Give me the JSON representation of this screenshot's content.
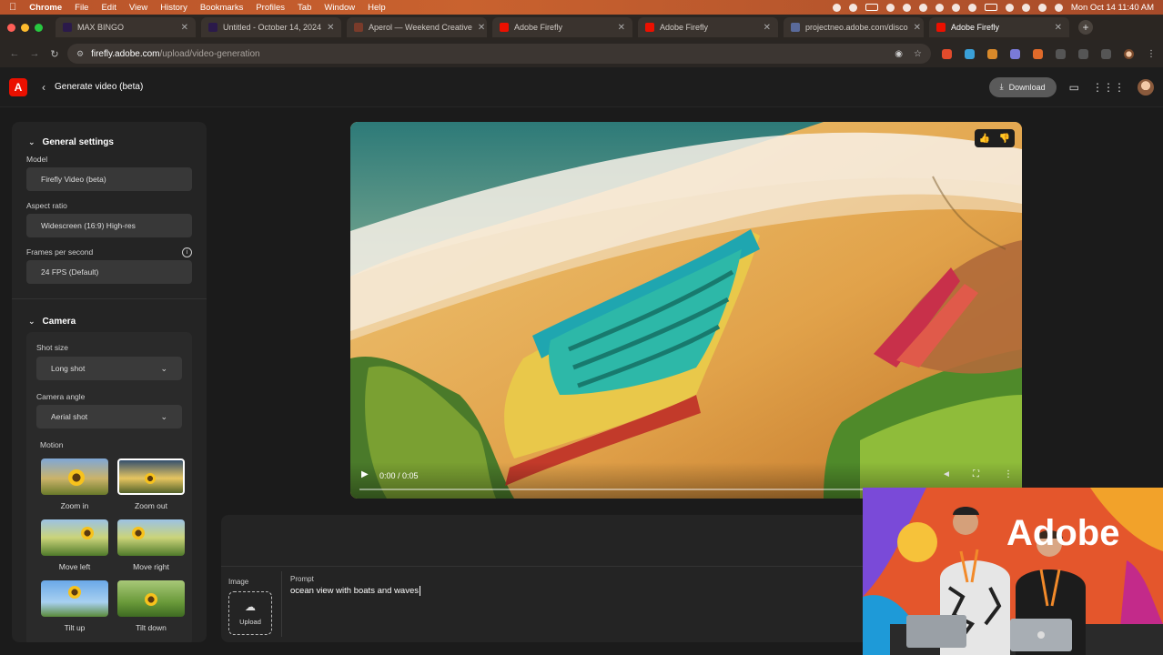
{
  "menubar": {
    "app": "Chrome",
    "items": [
      "File",
      "Edit",
      "View",
      "History",
      "Bookmarks",
      "Profiles",
      "Tab",
      "Window",
      "Help"
    ],
    "clock": "Mon Oct 14  11:40 AM"
  },
  "tabs": [
    {
      "title": "MAX BINGO",
      "favicon_color": "#2b1a4a"
    },
    {
      "title": "Untitled - October 14, 2024",
      "favicon_color": "#2b1a4a"
    },
    {
      "title": "Aperol — Weekend Creative",
      "favicon_color": "#7a3b2a"
    },
    {
      "title": "Adobe Firefly",
      "favicon_color": "#eb1000"
    },
    {
      "title": "Adobe Firefly",
      "favicon_color": "#eb1000"
    },
    {
      "title": "projectneo.adobe.com/disco",
      "favicon_color": "#5a6a9a"
    },
    {
      "title": "Adobe Firefly",
      "favicon_color": "#eb1000",
      "active": true
    }
  ],
  "address": {
    "host": "firefly.adobe.com",
    "path": "/upload/video-generation"
  },
  "header": {
    "title": "Generate video (beta)",
    "download_label": "Download",
    "logo_letter": "A"
  },
  "sidebar": {
    "general": {
      "title": "General settings",
      "model_label": "Model",
      "model_value": "Firefly Video (beta)",
      "aspect_label": "Aspect ratio",
      "aspect_value": "Widescreen (16:9) High-res",
      "fps_label": "Frames per second",
      "fps_value": "24 FPS (Default)"
    },
    "camera": {
      "title": "Camera",
      "shot_label": "Shot size",
      "shot_value": "Long shot",
      "angle_label": "Camera angle",
      "angle_value": "Aerial shot",
      "motion_label": "Motion",
      "motions": [
        "Zoom in",
        "Zoom out",
        "Move left",
        "Move right",
        "Tilt up",
        "Tilt down"
      ],
      "selected_motion": "Zoom out"
    }
  },
  "video": {
    "time": "0:00 / 0:05",
    "progress": 0.0
  },
  "prompt": {
    "image_label": "Image",
    "upload_label": "Upload",
    "prompt_label": "Prompt",
    "prompt_value": "ocean view with boats and waves"
  },
  "pip": {
    "backdrop_text": "Adobe"
  },
  "colors": {
    "accent": "#eb1000",
    "bg": "#1b1b1b",
    "panel": "#242424"
  }
}
